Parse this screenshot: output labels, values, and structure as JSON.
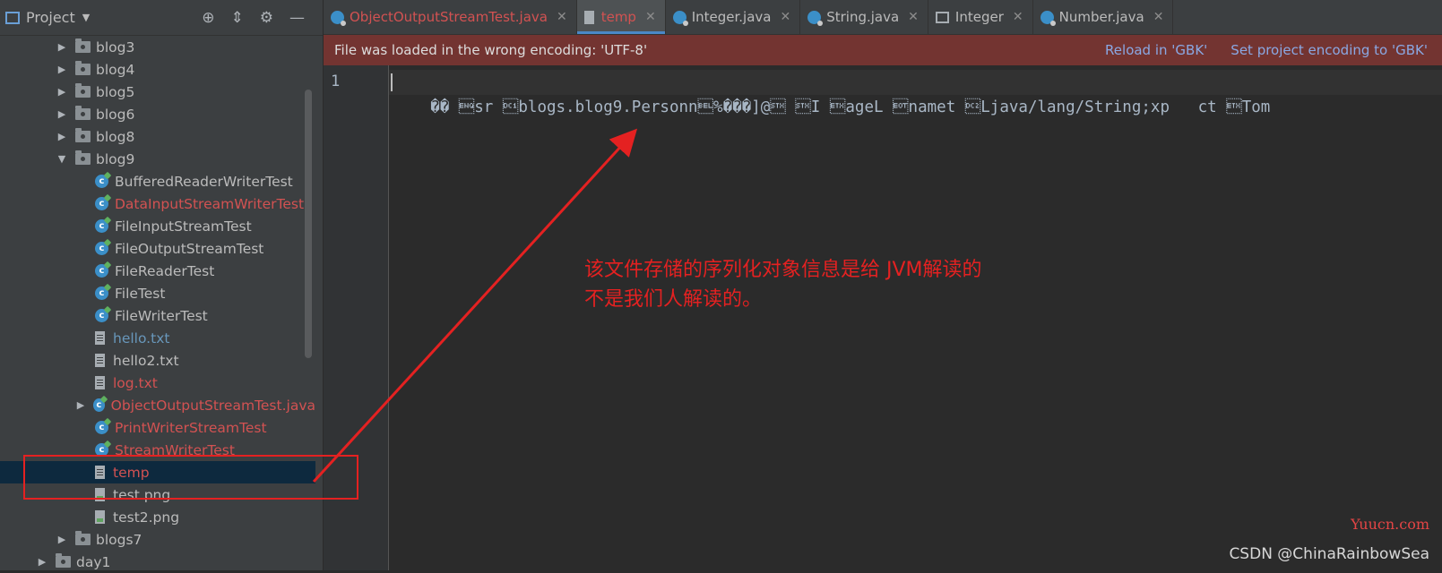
{
  "project_panel": {
    "title": "Project",
    "tree": [
      {
        "label": "blog3",
        "type": "folder",
        "depth": 0,
        "expanded": false,
        "color": "default"
      },
      {
        "label": "blog4",
        "type": "folder",
        "depth": 0,
        "expanded": false,
        "color": "default"
      },
      {
        "label": "blog5",
        "type": "folder",
        "depth": 0,
        "expanded": false,
        "color": "default"
      },
      {
        "label": "blog6",
        "type": "folder",
        "depth": 0,
        "expanded": false,
        "color": "default"
      },
      {
        "label": "blog8",
        "type": "folder",
        "depth": 0,
        "expanded": false,
        "color": "default"
      },
      {
        "label": "blog9",
        "type": "folder",
        "depth": 0,
        "expanded": true,
        "color": "default"
      },
      {
        "label": "BufferedReaderWriterTest",
        "type": "class",
        "depth": 1,
        "color": "default"
      },
      {
        "label": "DataInputStreamWriterTest",
        "type": "class",
        "depth": 1,
        "color": "red"
      },
      {
        "label": "FileInputStreamTest",
        "type": "class",
        "depth": 1,
        "color": "default"
      },
      {
        "label": "FileOutputStreamTest",
        "type": "class",
        "depth": 1,
        "color": "default"
      },
      {
        "label": "FileReaderTest",
        "type": "class",
        "depth": 1,
        "color": "default"
      },
      {
        "label": "FileTest",
        "type": "class",
        "depth": 1,
        "color": "default"
      },
      {
        "label": "FileWriterTest",
        "type": "class",
        "depth": 1,
        "color": "default"
      },
      {
        "label": "hello.txt",
        "type": "file",
        "depth": 1,
        "color": "blue"
      },
      {
        "label": "hello2.txt",
        "type": "file",
        "depth": 1,
        "color": "default"
      },
      {
        "label": "log.txt",
        "type": "file",
        "depth": 1,
        "color": "red"
      },
      {
        "label": "ObjectOutputStreamTest.java",
        "type": "class",
        "depth": 1,
        "collapsible": true,
        "color": "red"
      },
      {
        "label": "PrintWriterStreamTest",
        "type": "class",
        "depth": 1,
        "color": "red"
      },
      {
        "label": "StreamWriterTest",
        "type": "class",
        "depth": 1,
        "color": "red"
      },
      {
        "label": "temp",
        "type": "file",
        "depth": 1,
        "color": "red",
        "selected": true
      },
      {
        "label": "test.png",
        "type": "png",
        "depth": 1,
        "color": "default"
      },
      {
        "label": "test2.png",
        "type": "png",
        "depth": 1,
        "color": "default"
      },
      {
        "label": "blogs7",
        "type": "folder",
        "depth": 0,
        "expanded": false,
        "color": "default"
      },
      {
        "label": "day1",
        "type": "folder",
        "depth": -1,
        "expanded": false,
        "color": "default"
      }
    ]
  },
  "tabs": [
    {
      "label": "ObjectOutputStreamTest.java",
      "icon": "class",
      "color": "#d25252",
      "active": false
    },
    {
      "label": "temp",
      "icon": "file",
      "color": "#d25252",
      "active": true
    },
    {
      "label": "Integer.java",
      "icon": "class",
      "color": "#bbbbbb",
      "active": false
    },
    {
      "label": "String.java",
      "icon": "class",
      "color": "#bbbbbb",
      "active": false
    },
    {
      "label": "Integer",
      "icon": "structure",
      "color": "#bbbbbb",
      "active": false
    },
    {
      "label": "Number.java",
      "icon": "class",
      "color": "#bbbbbb",
      "active": false
    }
  ],
  "banner": {
    "message": "File was loaded in the wrong encoding: 'UTF-8'",
    "reload_action": "Reload in 'GBK'",
    "set_encoding_action": "Set project encoding to 'GBK'"
  },
  "editor": {
    "line_number": "1",
    "line_text": "�� \u0005sr \u0011blogs.blog9.Personn\u0007%���]@\u0002 \u0002I \u0003ageL \u0004namet \u0012Ljava/lang/String;xp   ct \u0003Tom"
  },
  "annotation": {
    "line1": "该文件存储的序列化对象信息是给 JVM解读的",
    "line2": "不是我们人解读的。"
  },
  "watermarks": {
    "yuucn": "Yuucn.com",
    "csdn": "CSDN @ChinaRainbowSea"
  },
  "colors": {
    "banner_bg": "#733431",
    "annotation_red": "#e42121",
    "link_blue": "#8aa8e3",
    "accent_tab": "#4a88c7"
  }
}
